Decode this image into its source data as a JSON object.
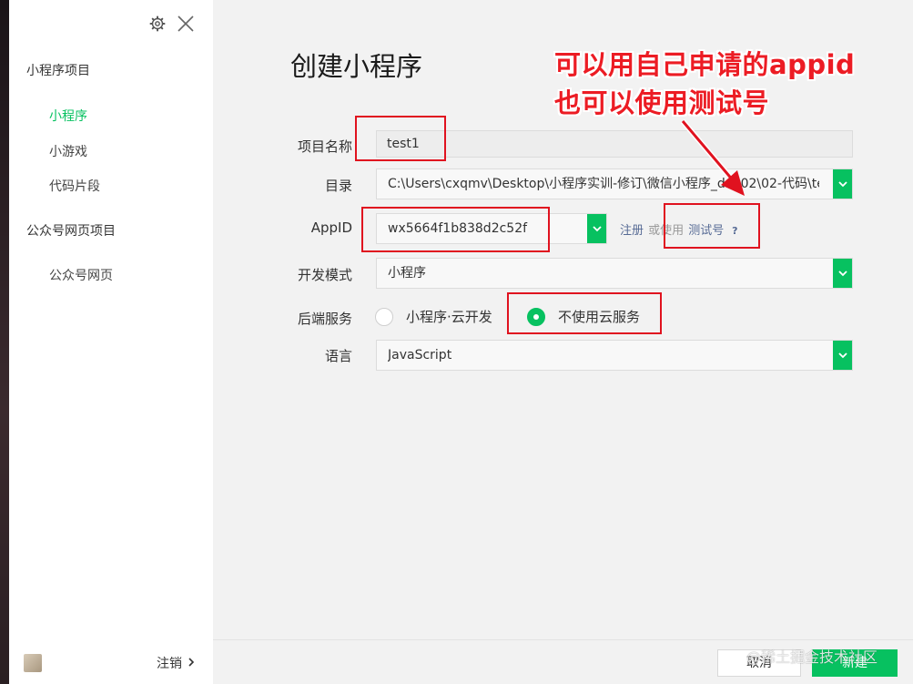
{
  "sidebar": {
    "section_miniprogram": "小程序项目",
    "items_miniprogram": [
      "小程序",
      "小游戏",
      "代码片段"
    ],
    "section_official": "公众号网页项目",
    "items_official": [
      "公众号网页"
    ],
    "logout_label": "注销",
    "icons": [
      "gear-icon",
      "close-icon",
      "chevron-right-icon"
    ]
  },
  "main": {
    "title": "创建小程序",
    "project_name_label": "项目名称",
    "project_name_value": "test1",
    "directory_label": "目录",
    "directory_value": "C:\\Users\\cxqmv\\Desktop\\小程序实训-修订\\微信小程序_day02\\02-代码\\te",
    "appid_label": "AppID",
    "appid_value": "wx5664f1b838d2c52f",
    "register_link": "注册",
    "or_text": "或使用",
    "test_account_link": "测试号",
    "help_symbol": "?",
    "dev_mode_label": "开发模式",
    "dev_mode_value": "小程序",
    "backend_label": "后端服务",
    "backend_options": [
      "小程序·云开发",
      "不使用云服务"
    ],
    "backend_selected_index": 1,
    "language_label": "语言",
    "language_value": "JavaScript"
  },
  "annotation": {
    "line1": "可以用自己申请的appid",
    "line2": "也可以使用测试号",
    "color": "#ec1c24"
  },
  "footer": {
    "cancel_label": "取消",
    "create_label": "新建"
  },
  "watermark": "@稀土掘金技术社区",
  "colors": {
    "accent": "#07c160",
    "link": "#576b95",
    "highlight_box": "#e0121f"
  }
}
